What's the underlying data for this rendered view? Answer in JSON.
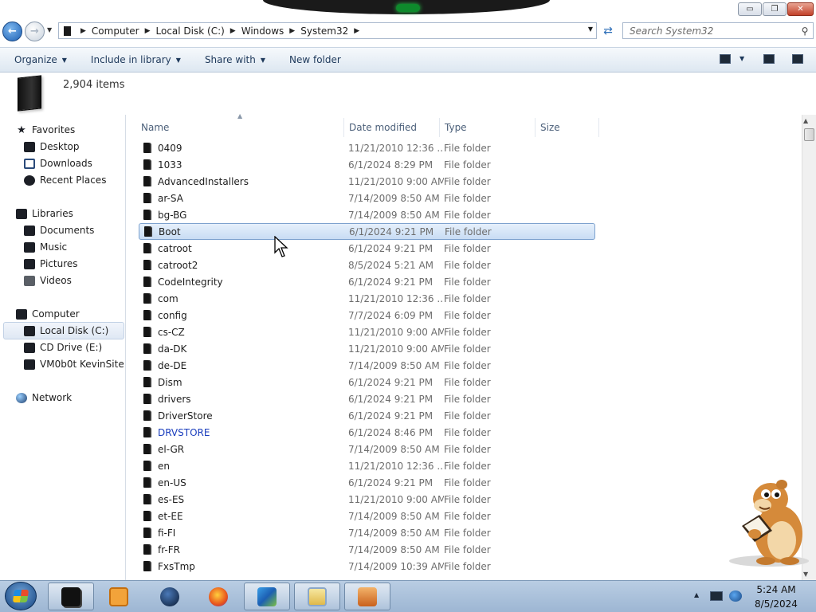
{
  "window": {
    "controls": {
      "minimize": "▭",
      "maximize": "❐",
      "close": "✕"
    }
  },
  "address": {
    "crumbs": [
      "Computer",
      "Local Disk (C:)",
      "Windows",
      "System32"
    ],
    "search_placeholder": "Search System32"
  },
  "toolbar": {
    "organize": "Organize",
    "include_in_library": "Include in library",
    "share_with": "Share with",
    "new_folder": "New folder"
  },
  "details": {
    "item_count": "2,904 items"
  },
  "nav": {
    "favorites": {
      "label": "Favorites",
      "items": [
        "Desktop",
        "Downloads",
        "Recent Places"
      ]
    },
    "libraries": {
      "label": "Libraries",
      "items": [
        "Documents",
        "Music",
        "Pictures",
        "Videos"
      ]
    },
    "computer": {
      "label": "Computer",
      "items": [
        "Local Disk (C:)",
        "CD Drive (E:)",
        "VM0b0t KevinSite"
      ]
    },
    "network": {
      "label": "Network"
    },
    "selected": "Local Disk (C:)"
  },
  "columns": {
    "name": "Name",
    "date": "Date modified",
    "type": "Type",
    "size": "Size"
  },
  "files": [
    {
      "name": "0409",
      "date": "11/21/2010 12:36 ...",
      "type": "File folder"
    },
    {
      "name": "1033",
      "date": "6/1/2024 8:29 PM",
      "type": "File folder"
    },
    {
      "name": "AdvancedInstallers",
      "date": "11/21/2010 9:00 AM",
      "type": "File folder"
    },
    {
      "name": "ar-SA",
      "date": "7/14/2009 8:50 AM",
      "type": "File folder"
    },
    {
      "name": "bg-BG",
      "date": "7/14/2009 8:50 AM",
      "type": "File folder"
    },
    {
      "name": "Boot",
      "date": "6/1/2024 9:21 PM",
      "type": "File folder",
      "selected": true
    },
    {
      "name": "catroot",
      "date": "6/1/2024 9:21 PM",
      "type": "File folder"
    },
    {
      "name": "catroot2",
      "date": "8/5/2024 5:21 AM",
      "type": "File folder"
    },
    {
      "name": "CodeIntegrity",
      "date": "6/1/2024 9:21 PM",
      "type": "File folder"
    },
    {
      "name": "com",
      "date": "11/21/2010 12:36 ...",
      "type": "File folder"
    },
    {
      "name": "config",
      "date": "7/7/2024 6:09 PM",
      "type": "File folder"
    },
    {
      "name": "cs-CZ",
      "date": "11/21/2010 9:00 AM",
      "type": "File folder"
    },
    {
      "name": "da-DK",
      "date": "11/21/2010 9:00 AM",
      "type": "File folder"
    },
    {
      "name": "de-DE",
      "date": "7/14/2009 8:50 AM",
      "type": "File folder"
    },
    {
      "name": "Dism",
      "date": "6/1/2024 9:21 PM",
      "type": "File folder"
    },
    {
      "name": "drivers",
      "date": "6/1/2024 9:21 PM",
      "type": "File folder"
    },
    {
      "name": "DriverStore",
      "date": "6/1/2024 9:21 PM",
      "type": "File folder"
    },
    {
      "name": "DRVSTORE",
      "date": "6/1/2024 8:46 PM",
      "type": "File folder",
      "highlight": true
    },
    {
      "name": "el-GR",
      "date": "7/14/2009 8:50 AM",
      "type": "File folder"
    },
    {
      "name": "en",
      "date": "11/21/2010 12:36 ...",
      "type": "File folder"
    },
    {
      "name": "en-US",
      "date": "6/1/2024 9:21 PM",
      "type": "File folder"
    },
    {
      "name": "es-ES",
      "date": "11/21/2010 9:00 AM",
      "type": "File folder"
    },
    {
      "name": "et-EE",
      "date": "7/14/2009 8:50 AM",
      "type": "File folder"
    },
    {
      "name": "fi-FI",
      "date": "7/14/2009 8:50 AM",
      "type": "File folder"
    },
    {
      "name": "fr-FR",
      "date": "7/14/2009 8:50 AM",
      "type": "File folder"
    },
    {
      "name": "FxsTmp",
      "date": "7/14/2009 10:39 AM",
      "type": "File folder"
    }
  ],
  "taskbar": {
    "buttons": [
      {
        "name": "explorer",
        "pinned": true
      },
      {
        "name": "media-player",
        "pinned": false
      },
      {
        "name": "app-orb",
        "pinned": false
      },
      {
        "name": "firefox",
        "pinned": false
      },
      {
        "name": "network-app",
        "pinned": true
      },
      {
        "name": "window-app",
        "pinned": true
      },
      {
        "name": "control-app",
        "pinned": true
      }
    ],
    "clock": {
      "time": "5:24 AM",
      "date": "8/5/2024"
    }
  },
  "colors": {
    "accent": "#1e395b",
    "link_folder": "#1a3dbd",
    "selection": "#c8dcf4"
  }
}
